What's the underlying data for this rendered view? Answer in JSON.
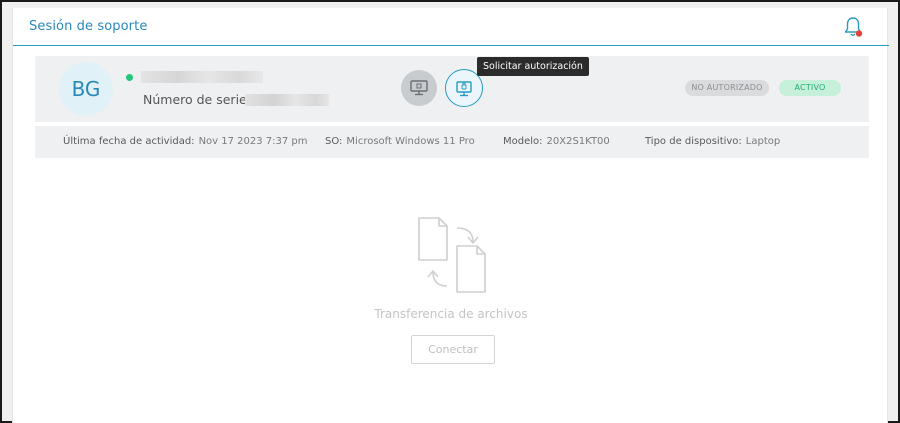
{
  "header": {
    "title": "Sesión de soporte",
    "notification_icon": "bell-icon",
    "notification_color": "#e8403a"
  },
  "device": {
    "initials": "BG",
    "status_color": "#21c77a",
    "serial_label": "Número de serie:",
    "badges": {
      "unauthorized": "NO AUTORIZADO",
      "active": "ACTIVO"
    },
    "actions": {
      "remote_icon": "monitor-icon",
      "request_icon": "request-authorization-icon",
      "tooltip": "Solicitar autorización"
    }
  },
  "info": {
    "last_activity_label": "Última fecha de actividad:",
    "last_activity_value": "Nov 17 2023 7:37 pm",
    "os_label": "SO:",
    "os_value": "Microsoft Windows 11 Pro",
    "model_label": "Modelo:",
    "model_value": "20X2S1KT00",
    "type_label": "Tipo de dispositivo:",
    "type_value": "Laptop"
  },
  "file_transfer": {
    "icon": "file-transfer-icon",
    "label": "Transferencia de archivos",
    "connect_label": "Conectar"
  },
  "colors": {
    "accent": "#2a9bc0",
    "title": "#2a88b8"
  }
}
